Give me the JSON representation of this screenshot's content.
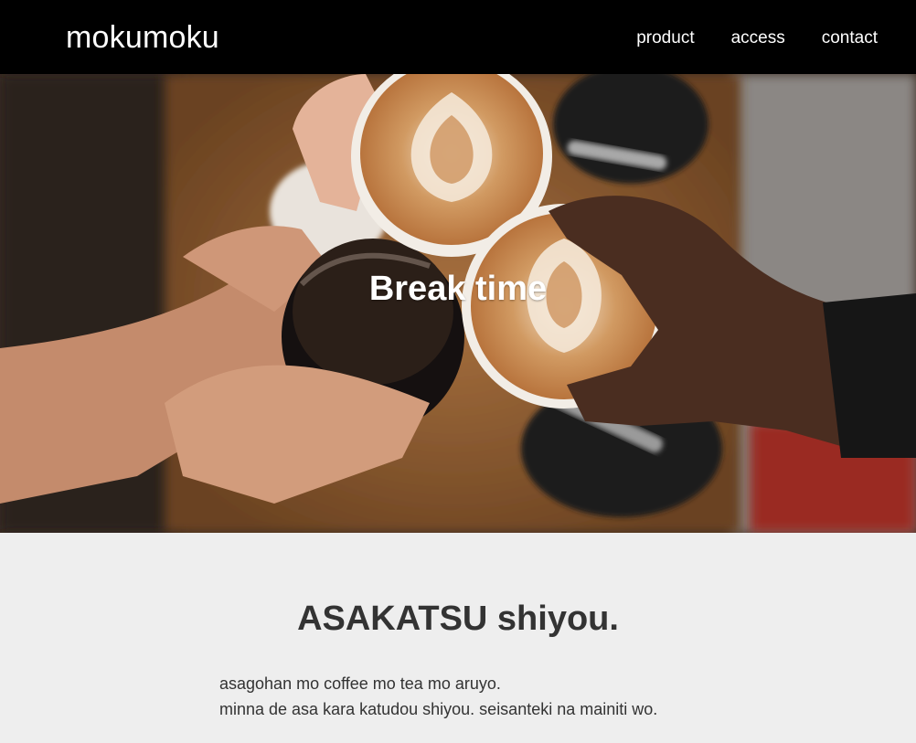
{
  "header": {
    "logo": "mokumoku",
    "nav": [
      {
        "label": "product"
      },
      {
        "label": "access"
      },
      {
        "label": "contact"
      }
    ]
  },
  "hero": {
    "title": "Break time",
    "image_description_icon": "coffee-cheers-photo"
  },
  "about": {
    "title": "ASAKATSU shiyou.",
    "lines": [
      "asagohan mo coffee mo tea mo aruyo.",
      "minna de asa kara katudou shiyou. seisanteki na mainiti wo."
    ]
  },
  "colors": {
    "header_bg": "#000000",
    "section_bg": "#eeeeee",
    "text_dark": "#333333",
    "text_light": "#ffffff"
  }
}
